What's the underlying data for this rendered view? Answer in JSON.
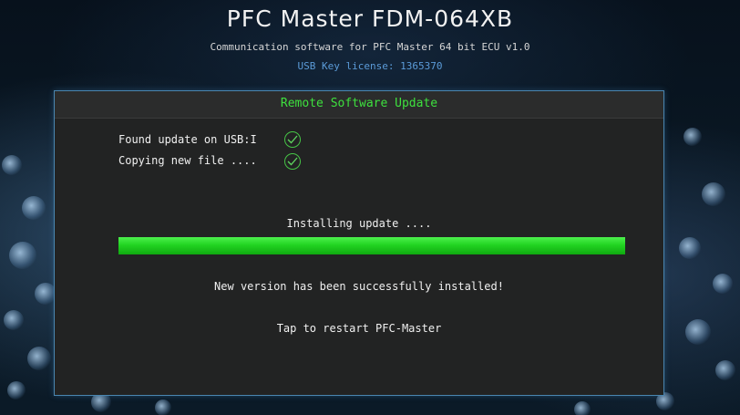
{
  "header": {
    "title": "PFC Master FDM-064XB",
    "subtitle": "Communication software for PFC Master 64 bit ECU v1.0",
    "license": "USB Key license: 1365370"
  },
  "dialog": {
    "title": "Remote Software Update",
    "steps": [
      {
        "label": "Found update on USB:I",
        "status_icon": "check-circle-icon"
      },
      {
        "label": "Copying new file ....",
        "status_icon": "check-circle-icon"
      }
    ],
    "installing_label": "Installing update ....",
    "progress": 1.0,
    "success_message": "New version has been successfully installed!",
    "restart_label": "Tap to restart PFC-Master"
  },
  "colors": {
    "accent_green": "#3ee03e",
    "license_blue": "#5b9bd8",
    "dialog_border": "#4a86b0"
  }
}
